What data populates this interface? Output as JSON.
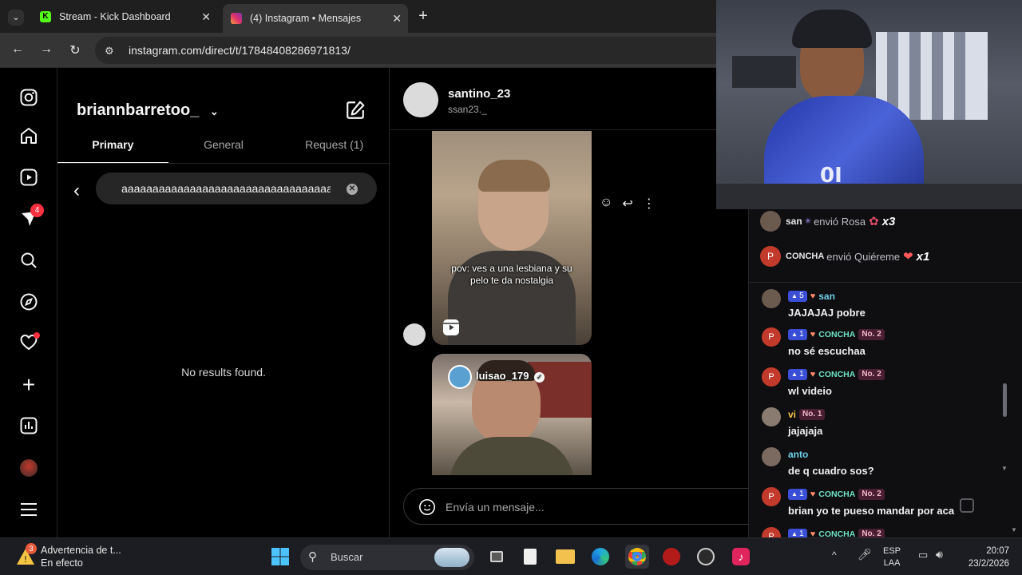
{
  "browser": {
    "tabs": [
      {
        "title": "Stream - Kick Dashboard"
      },
      {
        "title": "(4) Instagram • Mensajes"
      }
    ],
    "new_tab": "+",
    "url": "instagram.com/direct/t/17848408286971813/"
  },
  "instagram": {
    "rail_badge": "4",
    "username": "briannbarretoo_",
    "tabs": [
      "Primary",
      "General",
      "Request (1)"
    ],
    "search_query": "aaaaaaaaaaaaaaaaaaaaaaaaaaaaaaaaaaaa",
    "no_results": "No results found.",
    "chat_name": "santino_23",
    "chat_handle": "ssan23._",
    "reel1_caption": "pov: ves a una lesbiana y su pelo te da nostalgia",
    "reel2_author": "luisao_179",
    "composer_placeholder": "Envía un mensaje..."
  },
  "kick": {
    "gifts": [
      {
        "user": "san",
        "action": "envió Rosa",
        "count": "x3",
        "avatar_color": "#6b5a4e"
      },
      {
        "user": "CONCHA",
        "action": "envió Quiéreme",
        "count": "x1",
        "avatar_letter": "P",
        "avatar_color": "#c23a2b"
      }
    ],
    "messages": [
      {
        "user": "san",
        "sub": "5",
        "text": "JAJAJAJ pobre",
        "name_color": "#6fcfe8",
        "avatar_letter": "",
        "avatar_color": "#6b5a4e"
      },
      {
        "user": "CONCHA",
        "sub": "1",
        "rank": "No. 2",
        "text": "no sé escuchaa",
        "name_color": "#6fe0c2",
        "avatar_letter": "P",
        "avatar_color": "#c23a2b"
      },
      {
        "user": "CONCHA",
        "sub": "1",
        "rank": "No. 2",
        "text": "wl videio",
        "name_color": "#6fe0c2",
        "avatar_letter": "P",
        "avatar_color": "#c23a2b"
      },
      {
        "user": "vi",
        "rank": "No. 1",
        "text": "jajajaja",
        "name_color": "#f2c44a",
        "avatar_letter": "",
        "avatar_color": "#8a7b70"
      },
      {
        "user": "anto",
        "text": "de q cuadro sos?",
        "name_color": "#6fcfe8",
        "avatar_letter": "",
        "avatar_color": "#7a6a60"
      },
      {
        "user": "CONCHA",
        "sub": "1",
        "rank": "No. 2",
        "text": "brian yo te pueso mandar por aca",
        "name_color": "#6fe0c2",
        "avatar_letter": "P",
        "avatar_color": "#c23a2b"
      },
      {
        "user": "CONCHA",
        "sub": "1",
        "rank": "No. 2",
        "text": "??",
        "name_color": "#6fe0c2",
        "avatar_letter": "P",
        "avatar_color": "#c23a2b"
      }
    ]
  },
  "taskbar": {
    "notif_count": "3",
    "notif_title": "Advertencia de t...",
    "notif_sub": "En efecto",
    "search": "Buscar",
    "lang1": "ESP",
    "lang2": "LAA",
    "time": "20:07",
    "date": "23/2/2026"
  }
}
